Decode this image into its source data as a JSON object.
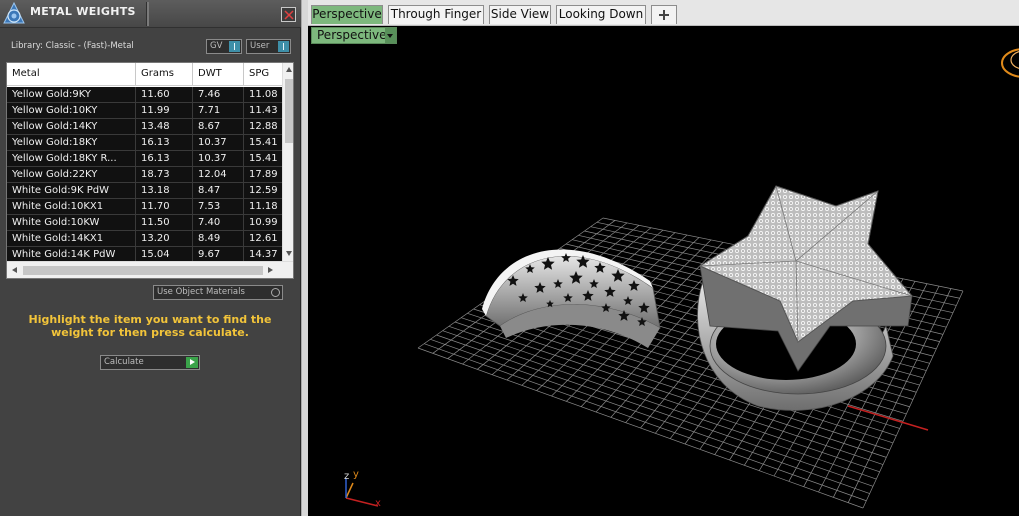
{
  "panel": {
    "title": "METAL WEIGHTS",
    "library_label": "Library: Classic - (Fast)-Metal",
    "gv_label": "GV",
    "user_label": "User",
    "table": {
      "columns": [
        "Metal",
        "Grams",
        "DWT",
        "SPG"
      ],
      "rows": [
        [
          "Yellow Gold:9KY",
          "11.60",
          "7.46",
          "11.08"
        ],
        [
          "Yellow Gold:10KY",
          "11.99",
          "7.71",
          "11.43"
        ],
        [
          "Yellow Gold:14KY",
          "13.48",
          "8.67",
          "12.88"
        ],
        [
          "Yellow Gold:18KY",
          "16.13",
          "10.37",
          "15.41"
        ],
        [
          "Yellow Gold:18KY R...",
          "16.13",
          "10.37",
          "15.41"
        ],
        [
          "Yellow Gold:22KY",
          "18.73",
          "12.04",
          "17.89"
        ],
        [
          "White Gold:9K PdW",
          "13.18",
          "8.47",
          "12.59"
        ],
        [
          "White Gold:10KX1",
          "11.70",
          "7.53",
          "11.18"
        ],
        [
          "White Gold:10KW",
          "11.50",
          "7.40",
          "10.99"
        ],
        [
          "White Gold:14KX1",
          "13.20",
          "8.49",
          "12.61"
        ],
        [
          "White Gold:14K PdW",
          "15.04",
          "9.67",
          "14.37"
        ]
      ]
    },
    "use_object_materials": "Use Object Materials",
    "instruction": "Highlight the item you want to find the weight for then press calculate.",
    "calculate_label": "Calculate"
  },
  "viewport": {
    "tabs": [
      "Perspective",
      "Through Finger",
      "Side View",
      "Looking Down"
    ],
    "active_tab": "Perspective",
    "view_dropdown": "Perspective",
    "axis_labels": {
      "z": "z",
      "y": "y",
      "x": "x"
    }
  },
  "colors": {
    "active_tab": "#7db87d",
    "instruction_text": "#f2c43a",
    "table_row_bg": "#111111",
    "toggle_indicator": "#3e8fa8",
    "calc_go": "#3aa34a"
  },
  "icons": [
    "app-logo-icon",
    "close-icon",
    "plus-icon",
    "dropdown-arrow-icon",
    "play-arrow-icon",
    "scroll-arrow-icons"
  ]
}
